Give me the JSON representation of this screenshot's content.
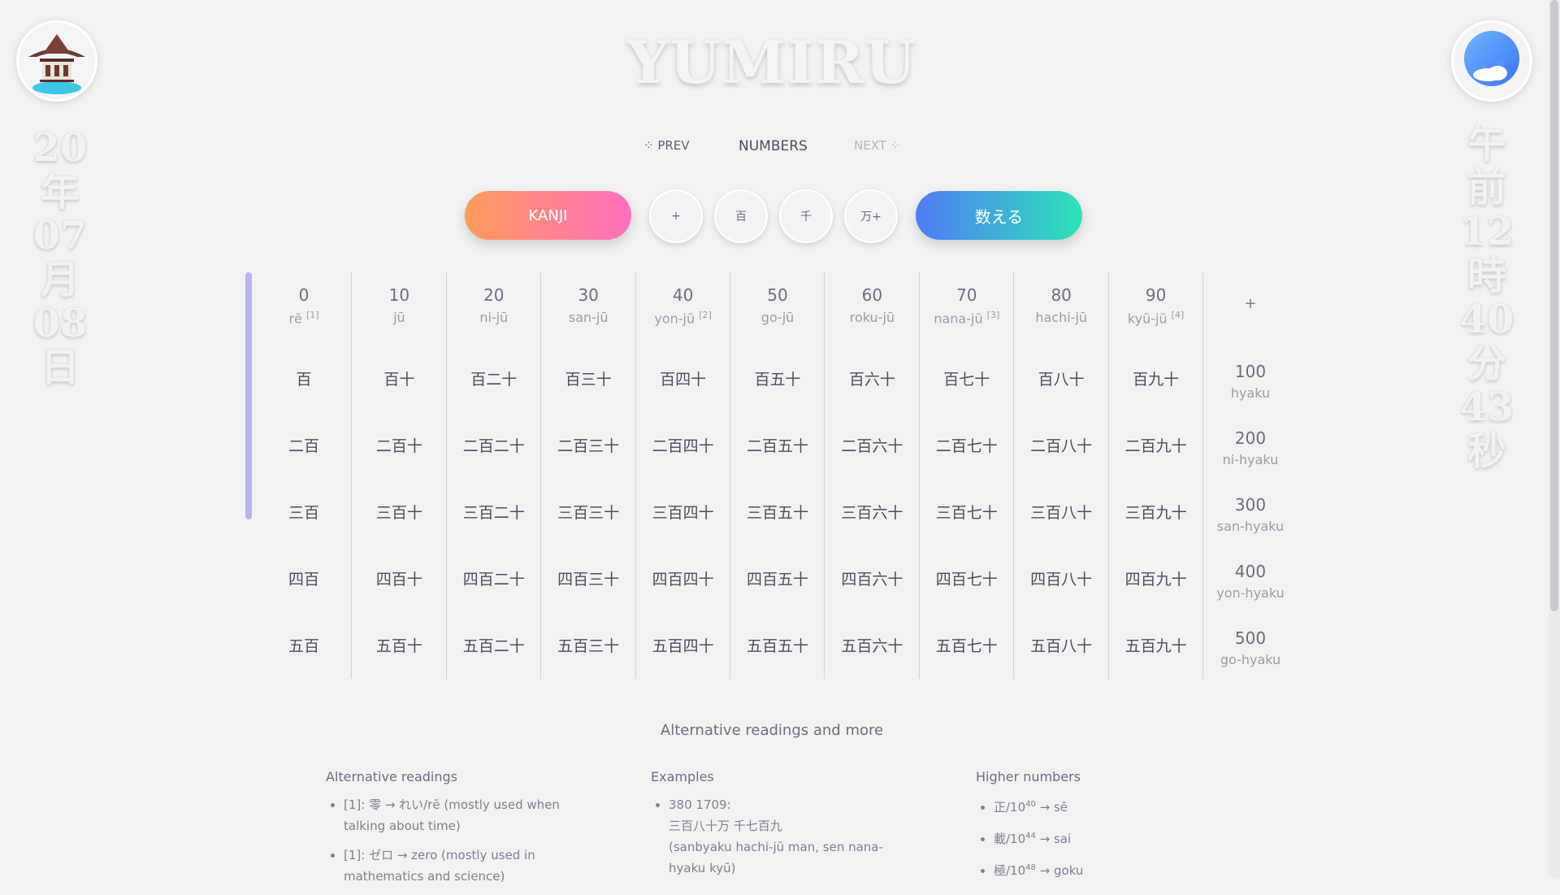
{
  "logo": "YUMIRU",
  "date_chars": [
    "20",
    "年",
    "07",
    "月",
    "08",
    "日"
  ],
  "time_chars": [
    "午",
    "前",
    "12",
    "時",
    "40",
    "分",
    "43",
    "秒"
  ],
  "nav": {
    "prev": "⁘ PREV",
    "title": "NUMBERS",
    "next": "NEXT ⁘"
  },
  "buttons": {
    "kanji": "KANJI",
    "plus": "+",
    "hyaku": "百",
    "sen": "千",
    "man": "万+",
    "count": "数える"
  },
  "columns": [
    {
      "num": "0",
      "rom": "rē",
      "note": "[1]",
      "cells": [
        "百",
        "二百",
        "三百",
        "四百",
        "五百"
      ]
    },
    {
      "num": "10",
      "rom": "jū",
      "note": "",
      "cells": [
        "百十",
        "二百十",
        "三百十",
        "四百十",
        "五百十"
      ]
    },
    {
      "num": "20",
      "rom": "ni-jū",
      "note": "",
      "cells": [
        "百二十",
        "二百二十",
        "三百二十",
        "四百二十",
        "五百二十"
      ]
    },
    {
      "num": "30",
      "rom": "san-jū",
      "note": "",
      "cells": [
        "百三十",
        "二百三十",
        "三百三十",
        "四百三十",
        "五百三十"
      ]
    },
    {
      "num": "40",
      "rom": "yon-jū",
      "note": "[2]",
      "cells": [
        "百四十",
        "二百四十",
        "三百四十",
        "四百四十",
        "五百四十"
      ]
    },
    {
      "num": "50",
      "rom": "go-jū",
      "note": "",
      "cells": [
        "百五十",
        "二百五十",
        "三百五十",
        "四百五十",
        "五百五十"
      ]
    },
    {
      "num": "60",
      "rom": "roku-jū",
      "note": "",
      "cells": [
        "百六十",
        "二百六十",
        "三百六十",
        "四百六十",
        "五百六十"
      ]
    },
    {
      "num": "70",
      "rom": "nana-jū",
      "note": "[3]",
      "cells": [
        "百七十",
        "二百七十",
        "三百七十",
        "四百七十",
        "五百七十"
      ]
    },
    {
      "num": "80",
      "rom": "hachi-jū",
      "note": "",
      "cells": [
        "百八十",
        "二百八十",
        "三百八十",
        "四百八十",
        "五百八十"
      ]
    },
    {
      "num": "90",
      "rom": "kyū-jū",
      "note": "[4]",
      "cells": [
        "百九十",
        "二百九十",
        "三百九十",
        "四百九十",
        "五百九十"
      ]
    }
  ],
  "plus_header": "+",
  "hundreds": [
    {
      "num": "100",
      "rom": "hyaku"
    },
    {
      "num": "200",
      "rom": "ni-hyaku"
    },
    {
      "num": "300",
      "rom": "san-hyaku"
    },
    {
      "num": "400",
      "rom": "yon-hyaku"
    },
    {
      "num": "500",
      "rom": "go-hyaku"
    }
  ],
  "alt_title": "Alternative readings and more",
  "info": {
    "alt": {
      "title": "Alternative readings",
      "items": [
        "[1]: 零 → れい/rē (mostly used when talking about time)",
        "[1]: ゼロ → zero (mostly used in mathematics and science)"
      ]
    },
    "examples": {
      "title": "Examples",
      "line1": "380 1709:",
      "line2": "三百八十万 千七百九",
      "line3": "(sanbyaku hachi-jū man, sen nana-hyaku kyū)"
    },
    "higher": {
      "title": "Higher numbers",
      "items": [
        {
          "pre": "正/10",
          "exp": "40",
          "post": " → sē"
        },
        {
          "pre": "載/10",
          "exp": "44",
          "post": " → sai"
        },
        {
          "pre": "極/10",
          "exp": "48",
          "post": " → goku"
        }
      ]
    }
  }
}
